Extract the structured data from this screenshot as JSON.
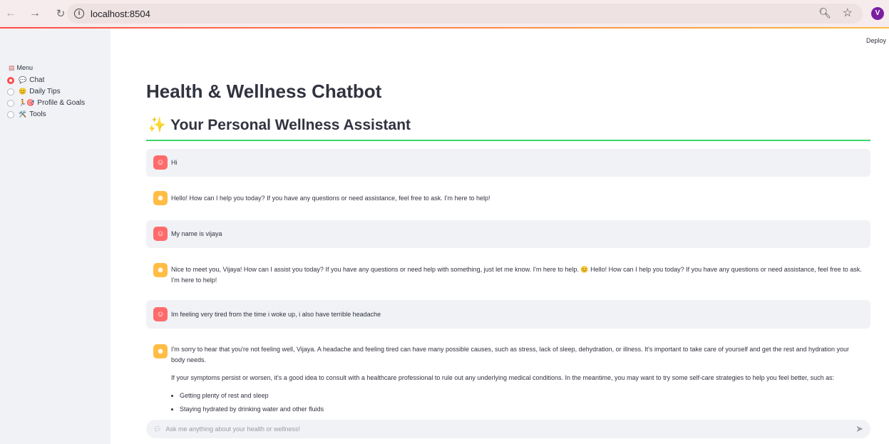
{
  "browser": {
    "url": "localhost:8504",
    "profile_initial": "V"
  },
  "sidebar": {
    "menu_title": "Menu",
    "items": [
      {
        "label": "Chat",
        "emoji": "💬",
        "selected": true
      },
      {
        "label": "Daily Tips",
        "emoji": "😊",
        "selected": false
      },
      {
        "label": "Profile & Goals",
        "emoji": "🏃🎯",
        "selected": false
      },
      {
        "label": "Tools",
        "emoji": "🛠️",
        "selected": false
      }
    ]
  },
  "header": {
    "deploy": "Deploy"
  },
  "main": {
    "title": "Health & Wellness Chatbot",
    "subtitle": "Your Personal Wellness Assistant",
    "subtitle_icon": "✨"
  },
  "messages": [
    {
      "role": "user",
      "text": "Hi"
    },
    {
      "role": "assistant",
      "text": "Hello! How can I help you today? If you have any questions or need assistance, feel free to ask. I'm here to help!"
    },
    {
      "role": "user",
      "text": "My name is vijaya"
    },
    {
      "role": "assistant",
      "text": "Nice to meet you, Vijaya! How can I assist you today? If you have any questions or need help with something, just let me know. I'm here to help. 😊 Hello! How can I help you today? If you have any questions or need assistance, feel free to ask. I'm here to help!"
    },
    {
      "role": "user",
      "text": "Im feeling very tired from the time i woke up, i also have terrible headache"
    },
    {
      "role": "assistant",
      "p1": "I'm sorry to hear that you're not feeling well, Vijaya. A headache and feeling tired can have many possible causes, such as stress, lack of sleep, dehydration, or illness. It's important to take care of yourself and get the rest and hydration your body needs.",
      "p2": "If your symptoms persist or worsen, it's a good idea to consult with a healthcare professional to rule out any underlying medical conditions. In the meantime, you may want to try some self-care strategies to help you feel better, such as:",
      "bullets": [
        "Getting plenty of rest and sleep",
        "Staying hydrated by drinking water and other fluids"
      ]
    }
  ],
  "chat_input": {
    "placeholder": "Ask me anything about your health or wellness!"
  },
  "colors": {
    "accent": "#ff4b4b",
    "divider": "#3dd56d",
    "user_avatar": "#ff6b6b",
    "bot_avatar": "#ffbd45"
  }
}
